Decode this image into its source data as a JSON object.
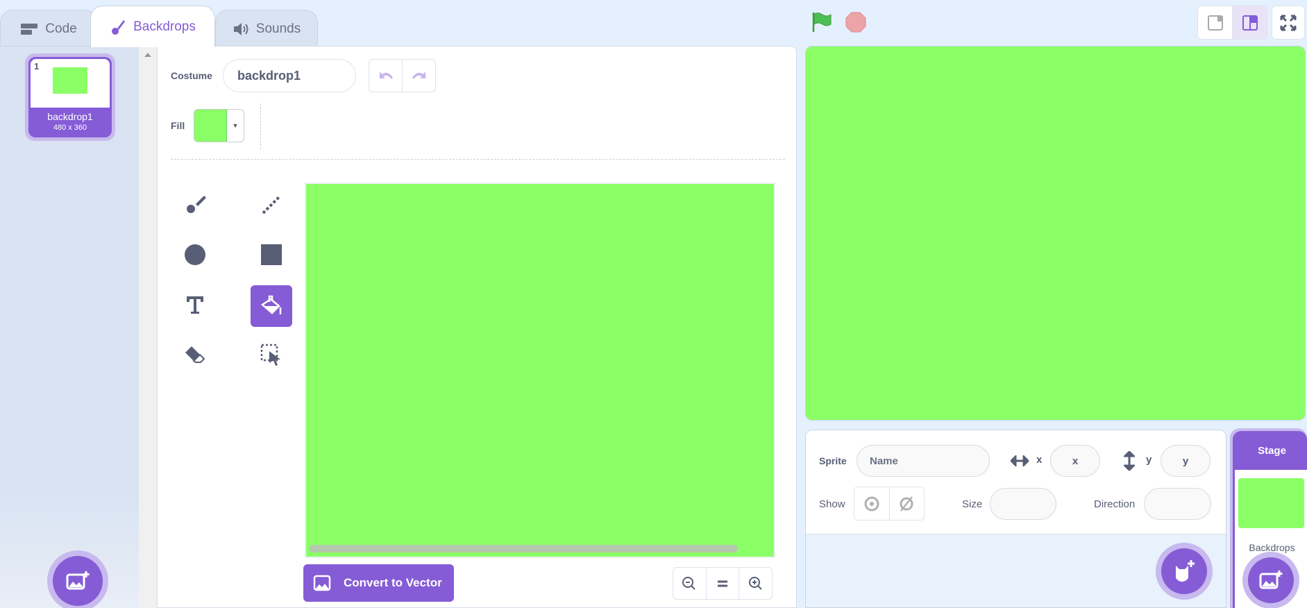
{
  "tabs": [
    {
      "label": "Code",
      "icon": "code-blocks-icon"
    },
    {
      "label": "Backdrops",
      "icon": "paintbrush-icon",
      "active": true
    },
    {
      "label": "Sounds",
      "icon": "speaker-icon"
    }
  ],
  "costume_list": {
    "items": [
      {
        "index": "1",
        "name": "backdrop1",
        "size": "480 x 360",
        "color": "#8aff66",
        "selected": true
      }
    ]
  },
  "editor": {
    "costume_label": "Costume",
    "costume_name": "backdrop1",
    "fill_label": "Fill",
    "fill_color": "#8aff66",
    "tools": [
      "brush",
      "line",
      "circle",
      "rectangle",
      "text",
      "fill",
      "eraser",
      "select"
    ],
    "selected_tool": "fill",
    "canvas_color": "#8aff66",
    "convert_label": "Convert to Vector"
  },
  "stage": {
    "color": "#8aff66"
  },
  "sprite_info": {
    "sprite_label": "Sprite",
    "name_placeholder": "Name",
    "x_label": "x",
    "x_placeholder": "x",
    "y_label": "y",
    "y_placeholder": "y",
    "show_label": "Show",
    "size_label": "Size",
    "direction_label": "Direction"
  },
  "stage_selector": {
    "title": "Stage",
    "backdrops_label": "Backdrops"
  },
  "colors": {
    "accent": "#855cd6",
    "text": "#575e75",
    "backdrop": "#8aff66"
  }
}
